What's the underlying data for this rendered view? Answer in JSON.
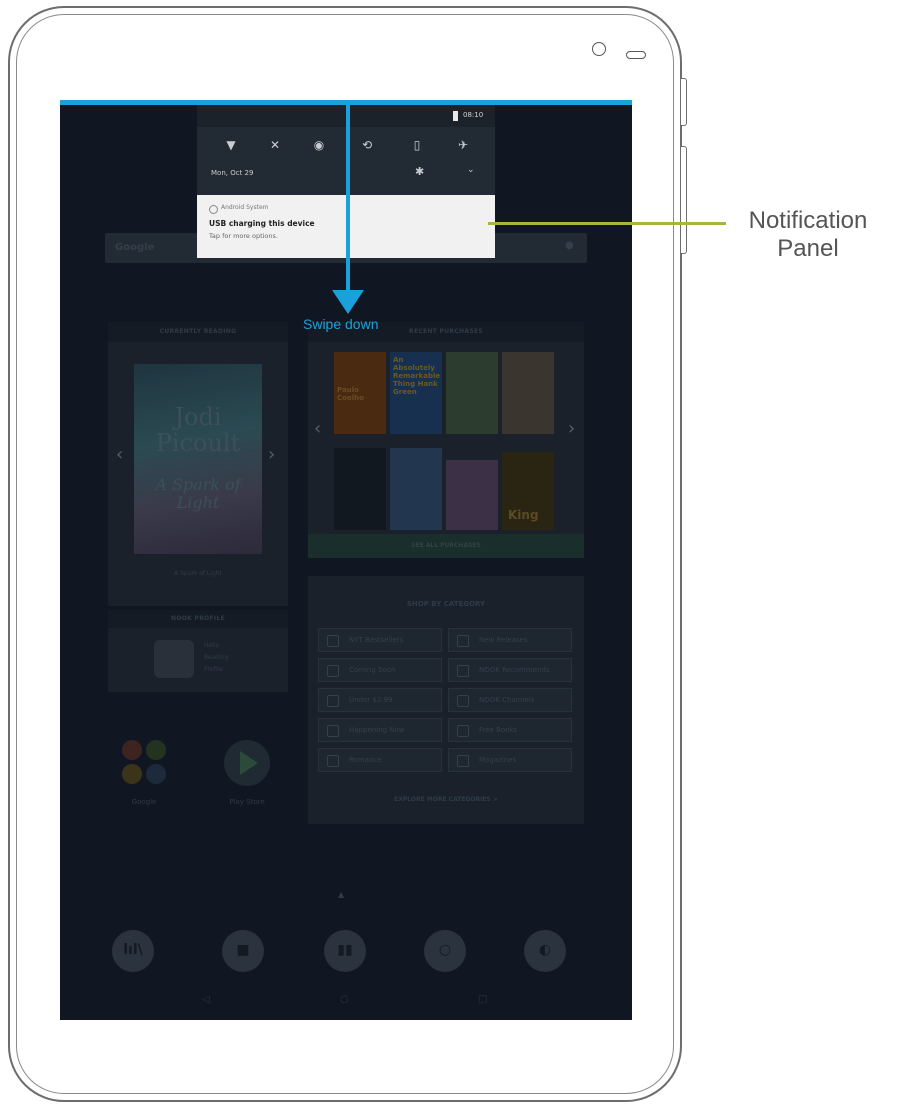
{
  "annotations": {
    "swipe_label": "Swipe down",
    "callout_label_line1": "Notification",
    "callout_label_line2": "Panel",
    "colors": {
      "arrow": "#1aa1dc",
      "callout": "#a9b43a"
    }
  },
  "notification_panel": {
    "status_time": "08:10",
    "date": "Mon, Oct 29",
    "quick_settings": [
      "wifi-icon",
      "bluetooth-icon",
      "do-not-disturb-icon",
      "auto-rotate-icon",
      "battery-saver-icon",
      "airplane-mode-icon"
    ],
    "notification": {
      "app": "Android System",
      "title": "USB charging this device",
      "subtitle": "Tap for more options."
    }
  },
  "home": {
    "search_label": "Google",
    "currently_reading": {
      "header": "CURRENTLY READING",
      "author": "Jodi Picoult",
      "book_title": "A Spark of Light",
      "caption": "A Spark of Light"
    },
    "recent_purchases": {
      "header": "RECENT PURCHASES",
      "footer": "SEE ALL PURCHASES",
      "covers": [
        "Paulo Coelho",
        "An Absolutely Remarkable Thing Hank Green",
        "",
        "",
        "",
        "",
        "",
        "King"
      ]
    },
    "nook_profile": {
      "header": "NOOK PROFILE",
      "name": "Hello",
      "line2": "Reading",
      "line3": "Profile"
    },
    "shop_by_category": {
      "header": "SHOP BY CATEGORY",
      "items": [
        "NYT Bestsellers",
        "New Releases",
        "Coming Soon",
        "NOOK Recommends",
        "Under $2.99",
        "NOOK Channels",
        "Happening Now",
        "Free Books",
        "Romance",
        "Magazines"
      ],
      "explore": "EXPLORE MORE CATEGORIES >"
    },
    "apps": [
      {
        "label": "Google"
      },
      {
        "label": "Play Store"
      }
    ],
    "dock": [
      "library-icon",
      "shop-icon",
      "reader-icon",
      "search-icon",
      "nook-icon"
    ]
  }
}
